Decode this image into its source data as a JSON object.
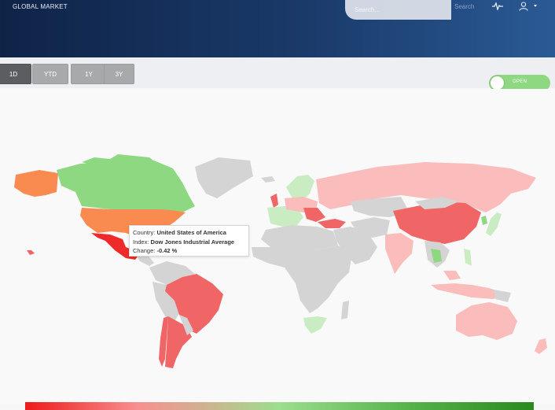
{
  "header": {
    "title": "GLOBAL MARKET",
    "search_placeholder": "Search...",
    "search_button": "Search",
    "pulse_icon": "activity-pulse-icon",
    "user_icon": "user-icon"
  },
  "range_tabs": [
    {
      "label": "1D",
      "active": true
    },
    {
      "label": "YTD",
      "active": false
    },
    {
      "label": "1Y",
      "active": false
    },
    {
      "label": "3Y",
      "active": false
    }
  ],
  "toggle": {
    "label": "OPEN",
    "on": true
  },
  "tooltip": {
    "country_label": "Country:",
    "country": "United States of America",
    "index_label": "Index:",
    "index": "Dow Jones Industrial Average",
    "change_label": "Change:",
    "change": "-0.42 %"
  },
  "colors": {
    "header_start": "#0f2347",
    "header_end": "#2a5a95",
    "no_data": "#d4d4d4",
    "strong_negative": "#ee2a2a",
    "negative": "#f06565",
    "mild_negative": "#fbbcbc",
    "orange": "#f98a50",
    "positive": "#8ed882",
    "mild_positive": "#c9ecc2"
  },
  "legend": {
    "from_color": "#ee1a1a",
    "to_color": "#2a8a1d"
  }
}
